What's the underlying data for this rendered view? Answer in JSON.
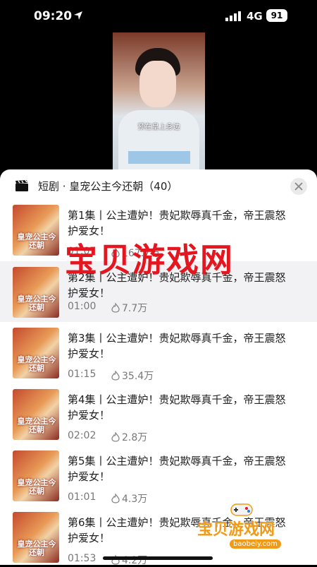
{
  "status": {
    "time": "09:20",
    "network": "4G",
    "battery": "91"
  },
  "video": {
    "subtitle": "预在皇上身边"
  },
  "sheet": {
    "title": "短剧 · 皇宠公主今还朝（40）"
  },
  "thumb_caption": "皇宠公主今还朝",
  "episodes": [
    {
      "title": "第1集丨公主遭妒！贵妃欺辱真千金，帝王震怒护爱女！",
      "duration": "01:07",
      "plays": "167.7万"
    },
    {
      "title": "第2集丨公主遭妒！贵妃欺辱真千金，帝王震怒护爱女！",
      "duration": "01:00",
      "plays": "7.7万"
    },
    {
      "title": "第3集丨公主遭妒！贵妃欺辱真千金，帝王震怒护爱女！",
      "duration": "01:15",
      "plays": "35.4万"
    },
    {
      "title": "第4集丨公主遭妒！贵妃欺辱真千金，帝王震怒护爱女！",
      "duration": "02:02",
      "plays": "2.8万"
    },
    {
      "title": "第5集丨公主遭妒！贵妃欺辱真千金，帝王震怒护爱女！",
      "duration": "01:01",
      "plays": "4.3万"
    },
    {
      "title": "第6集丨公主遭妒！贵妃欺辱真千金，帝王震怒护爱女！",
      "duration": "01:53",
      "plays": "4.2万"
    }
  ],
  "watermark": {
    "main": "宝贝游戏网",
    "corner": "宝贝游戏网",
    "url": "baobeiy.com"
  },
  "colors": {
    "watermark_red": "#e4161f",
    "watermark_orange": "#f19a16",
    "active_row": "#f2f2f4"
  }
}
